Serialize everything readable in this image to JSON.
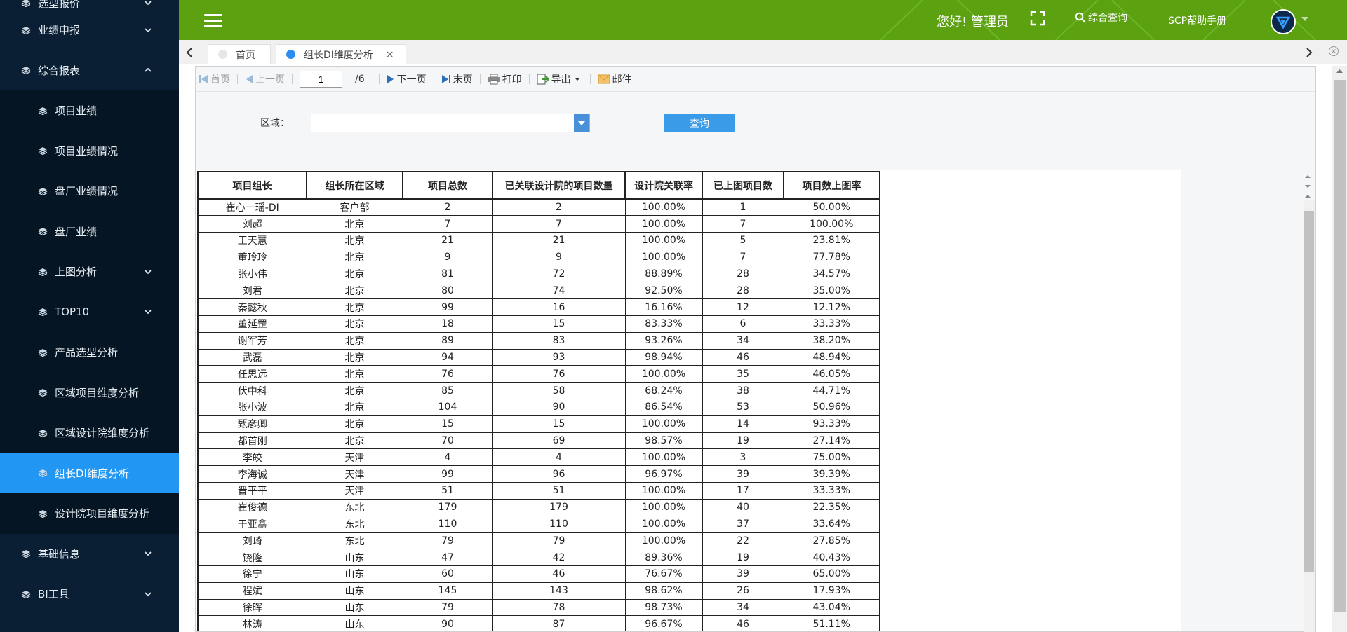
{
  "sidebar": {
    "items": [
      {
        "label": "选型报价",
        "type": "top",
        "chevron": "down"
      },
      {
        "label": "业绩申报",
        "type": "top",
        "chevron": "down"
      },
      {
        "label": "综合报表",
        "type": "top",
        "chevron": "up"
      },
      {
        "label": "项目业绩",
        "type": "sub"
      },
      {
        "label": "项目业绩情况",
        "type": "sub"
      },
      {
        "label": "盘厂业绩情况",
        "type": "sub"
      },
      {
        "label": "盘厂业绩",
        "type": "sub"
      },
      {
        "label": "上图分析",
        "type": "sub",
        "chevron": "down"
      },
      {
        "label": "TOP10",
        "type": "sub",
        "chevron": "down"
      },
      {
        "label": "产品选型分析",
        "type": "sub"
      },
      {
        "label": "区域项目维度分析",
        "type": "sub"
      },
      {
        "label": "区域设计院维度分析",
        "type": "sub"
      },
      {
        "label": "组长DI维度分析",
        "type": "sub",
        "active": true
      },
      {
        "label": "设计院项目维度分析",
        "type": "sub"
      },
      {
        "label": "基础信息",
        "type": "top",
        "chevron": "down"
      },
      {
        "label": "BI工具",
        "type": "top",
        "chevron": "down"
      }
    ]
  },
  "header": {
    "greeting": "您好! 管理员",
    "search_label": "综合查询",
    "help_label": "SCP帮助手册",
    "brand_color": "#5ba110"
  },
  "tabs": [
    {
      "label": "首页",
      "active": false
    },
    {
      "label": "组长DI维度分析",
      "active": true,
      "close": "×"
    }
  ],
  "toolbar": {
    "first": "首页",
    "prev": "上一页",
    "page_value": "1",
    "page_total": "/6",
    "next": "下一页",
    "last": "末页",
    "print": "打印",
    "export": "导出",
    "mail": "邮件"
  },
  "filter": {
    "region_label": "区域：",
    "region_value": "",
    "query_label": "查询"
  },
  "table": {
    "columns": [
      "项目组长",
      "组长所在区域",
      "项目总数",
      "已关联设计院的项目数量",
      "设计院关联率",
      "已上图项目数",
      "项目数上图率"
    ],
    "rows": [
      [
        "崔心一瑶-DI",
        "客户部",
        "2",
        "2",
        "100.00%",
        "1",
        "50.00%"
      ],
      [
        "刘超",
        "北京",
        "7",
        "7",
        "100.00%",
        "7",
        "100.00%"
      ],
      [
        "王天慧",
        "北京",
        "21",
        "21",
        "100.00%",
        "5",
        "23.81%"
      ],
      [
        "董玲玲",
        "北京",
        "9",
        "9",
        "100.00%",
        "7",
        "77.78%"
      ],
      [
        "张小伟",
        "北京",
        "81",
        "72",
        "88.89%",
        "28",
        "34.57%"
      ],
      [
        "刘君",
        "北京",
        "80",
        "74",
        "92.50%",
        "28",
        "35.00%"
      ],
      [
        "秦懿秋",
        "北京",
        "99",
        "16",
        "16.16%",
        "12",
        "12.12%"
      ],
      [
        "董延罡",
        "北京",
        "18",
        "15",
        "83.33%",
        "6",
        "33.33%"
      ],
      [
        "谢军芳",
        "北京",
        "89",
        "83",
        "93.26%",
        "34",
        "38.20%"
      ],
      [
        "武磊",
        "北京",
        "94",
        "93",
        "98.94%",
        "46",
        "48.94%"
      ],
      [
        "任思远",
        "北京",
        "76",
        "76",
        "100.00%",
        "35",
        "46.05%"
      ],
      [
        "伏中科",
        "北京",
        "85",
        "58",
        "68.24%",
        "38",
        "44.71%"
      ],
      [
        "张小波",
        "北京",
        "104",
        "90",
        "86.54%",
        "53",
        "50.96%"
      ],
      [
        "甄彦卿",
        "北京",
        "15",
        "15",
        "100.00%",
        "14",
        "93.33%"
      ],
      [
        "都首刚",
        "北京",
        "70",
        "69",
        "98.57%",
        "19",
        "27.14%"
      ],
      [
        "李皎",
        "天津",
        "4",
        "4",
        "100.00%",
        "3",
        "75.00%"
      ],
      [
        "李海诚",
        "天津",
        "99",
        "96",
        "96.97%",
        "39",
        "39.39%"
      ],
      [
        "晋平平",
        "天津",
        "51",
        "51",
        "100.00%",
        "17",
        "33.33%"
      ],
      [
        "崔俊德",
        "东北",
        "179",
        "179",
        "100.00%",
        "40",
        "22.35%"
      ],
      [
        "于亚鑫",
        "东北",
        "110",
        "110",
        "100.00%",
        "37",
        "33.64%"
      ],
      [
        "刘琦",
        "东北",
        "79",
        "79",
        "100.00%",
        "22",
        "27.85%"
      ],
      [
        "饶隆",
        "山东",
        "47",
        "42",
        "89.36%",
        "19",
        "40.43%"
      ],
      [
        "徐宁",
        "山东",
        "60",
        "46",
        "76.67%",
        "39",
        "65.00%"
      ],
      [
        "程斌",
        "山东",
        "145",
        "143",
        "98.62%",
        "26",
        "17.93%"
      ],
      [
        "徐晖",
        "山东",
        "79",
        "78",
        "98.73%",
        "34",
        "43.04%"
      ],
      [
        "林涛",
        "山东",
        "90",
        "87",
        "96.67%",
        "46",
        "51.11%"
      ]
    ]
  }
}
